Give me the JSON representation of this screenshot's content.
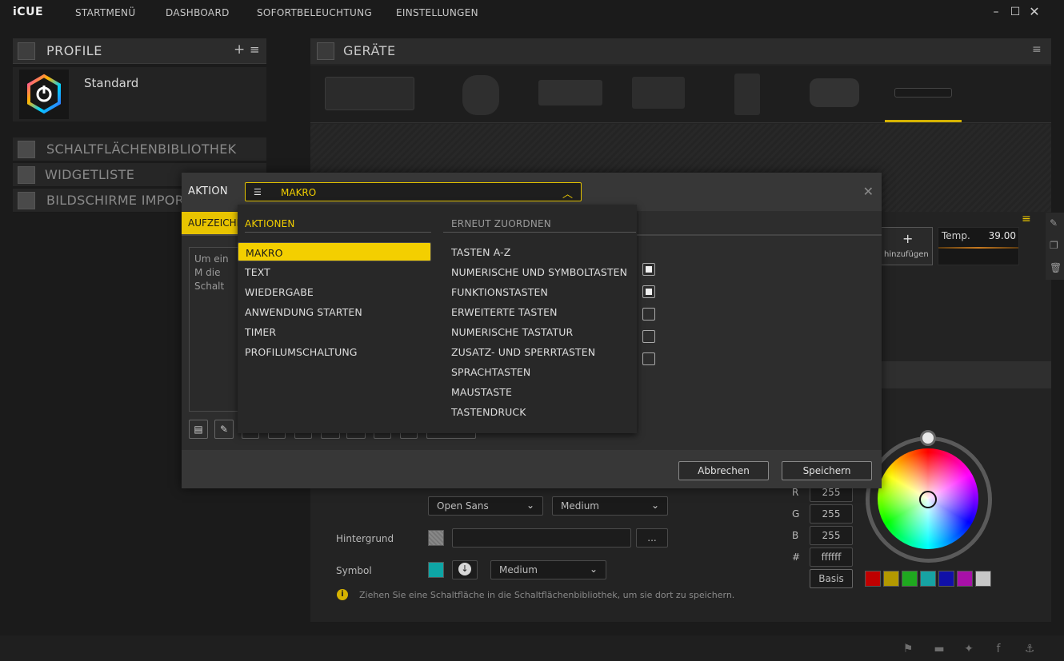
{
  "app": {
    "logo": "iCUE",
    "nav": [
      "STARTMENÜ",
      "DASHBOARD",
      "SOFORTBELEUCHTUNG",
      "EINSTELLUNGEN"
    ]
  },
  "left": {
    "profile_title": "PROFILE",
    "profile_name": "Standard",
    "rows": [
      "SCHALTFLÄCHENBIBLIOTHEK",
      "WIDGETLISTE",
      "BILDSCHIRME IMPOR"
    ]
  },
  "main": {
    "devices_title": "GERÄTE",
    "add_text": "hinzufügen",
    "temp_label": "Temp.",
    "temp_value": "39.00"
  },
  "form": {
    "font_select": "Open Sans",
    "weight_select_1": "Medium",
    "background_label": "Hintergrund",
    "browse_label": "...",
    "symbol_label": "Symbol",
    "weight_select_2": "Medium",
    "info_text": "Ziehen Sie eine Schaltfläche in die Schaltflächenbibliothek, um sie dort zu speichern.",
    "rgb": {
      "r_label": "R",
      "g_label": "G",
      "b_label": "B",
      "hash_label": "#",
      "r": "255",
      "g": "255",
      "b": "255",
      "hex": "ffffff"
    },
    "basis_label": "Basis",
    "preset_colors": [
      "#c00000",
      "#b39900",
      "#1fa81f",
      "#17a3a3",
      "#1010a8",
      "#a810a8",
      "#c8c8c8"
    ],
    "symbol_color": "#0ea5a5"
  },
  "dialog": {
    "title": "AKTION",
    "selected": "MAKRO",
    "tab_label": "AUFZEICHN",
    "text_preview": "Um ein M die Schalt",
    "cancel_label": "Abbrechen",
    "save_label": "Speichern"
  },
  "dropdown": {
    "left_header": "AKTIONEN",
    "right_header": "ERNEUT ZUORDNEN",
    "left_items": [
      "MAKRO",
      "TEXT",
      "WIEDERGABE",
      "ANWENDUNG STARTEN",
      "TIMER",
      "PROFILUMSCHALTUNG"
    ],
    "right_items": [
      "TASTEN A-Z",
      "NUMERISCHE UND SYMBOLTASTEN",
      "FUNKTIONSTASTEN",
      "ERWEITERTE TASTEN",
      "NUMERISCHE TASTATUR",
      "ZUSATZ- UND SPERRTASTEN",
      "SPRACHTASTEN",
      "MAUSTASTE",
      "TASTENDRUCK"
    ],
    "selected_index": 0
  },
  "accent": "#f3cf00"
}
